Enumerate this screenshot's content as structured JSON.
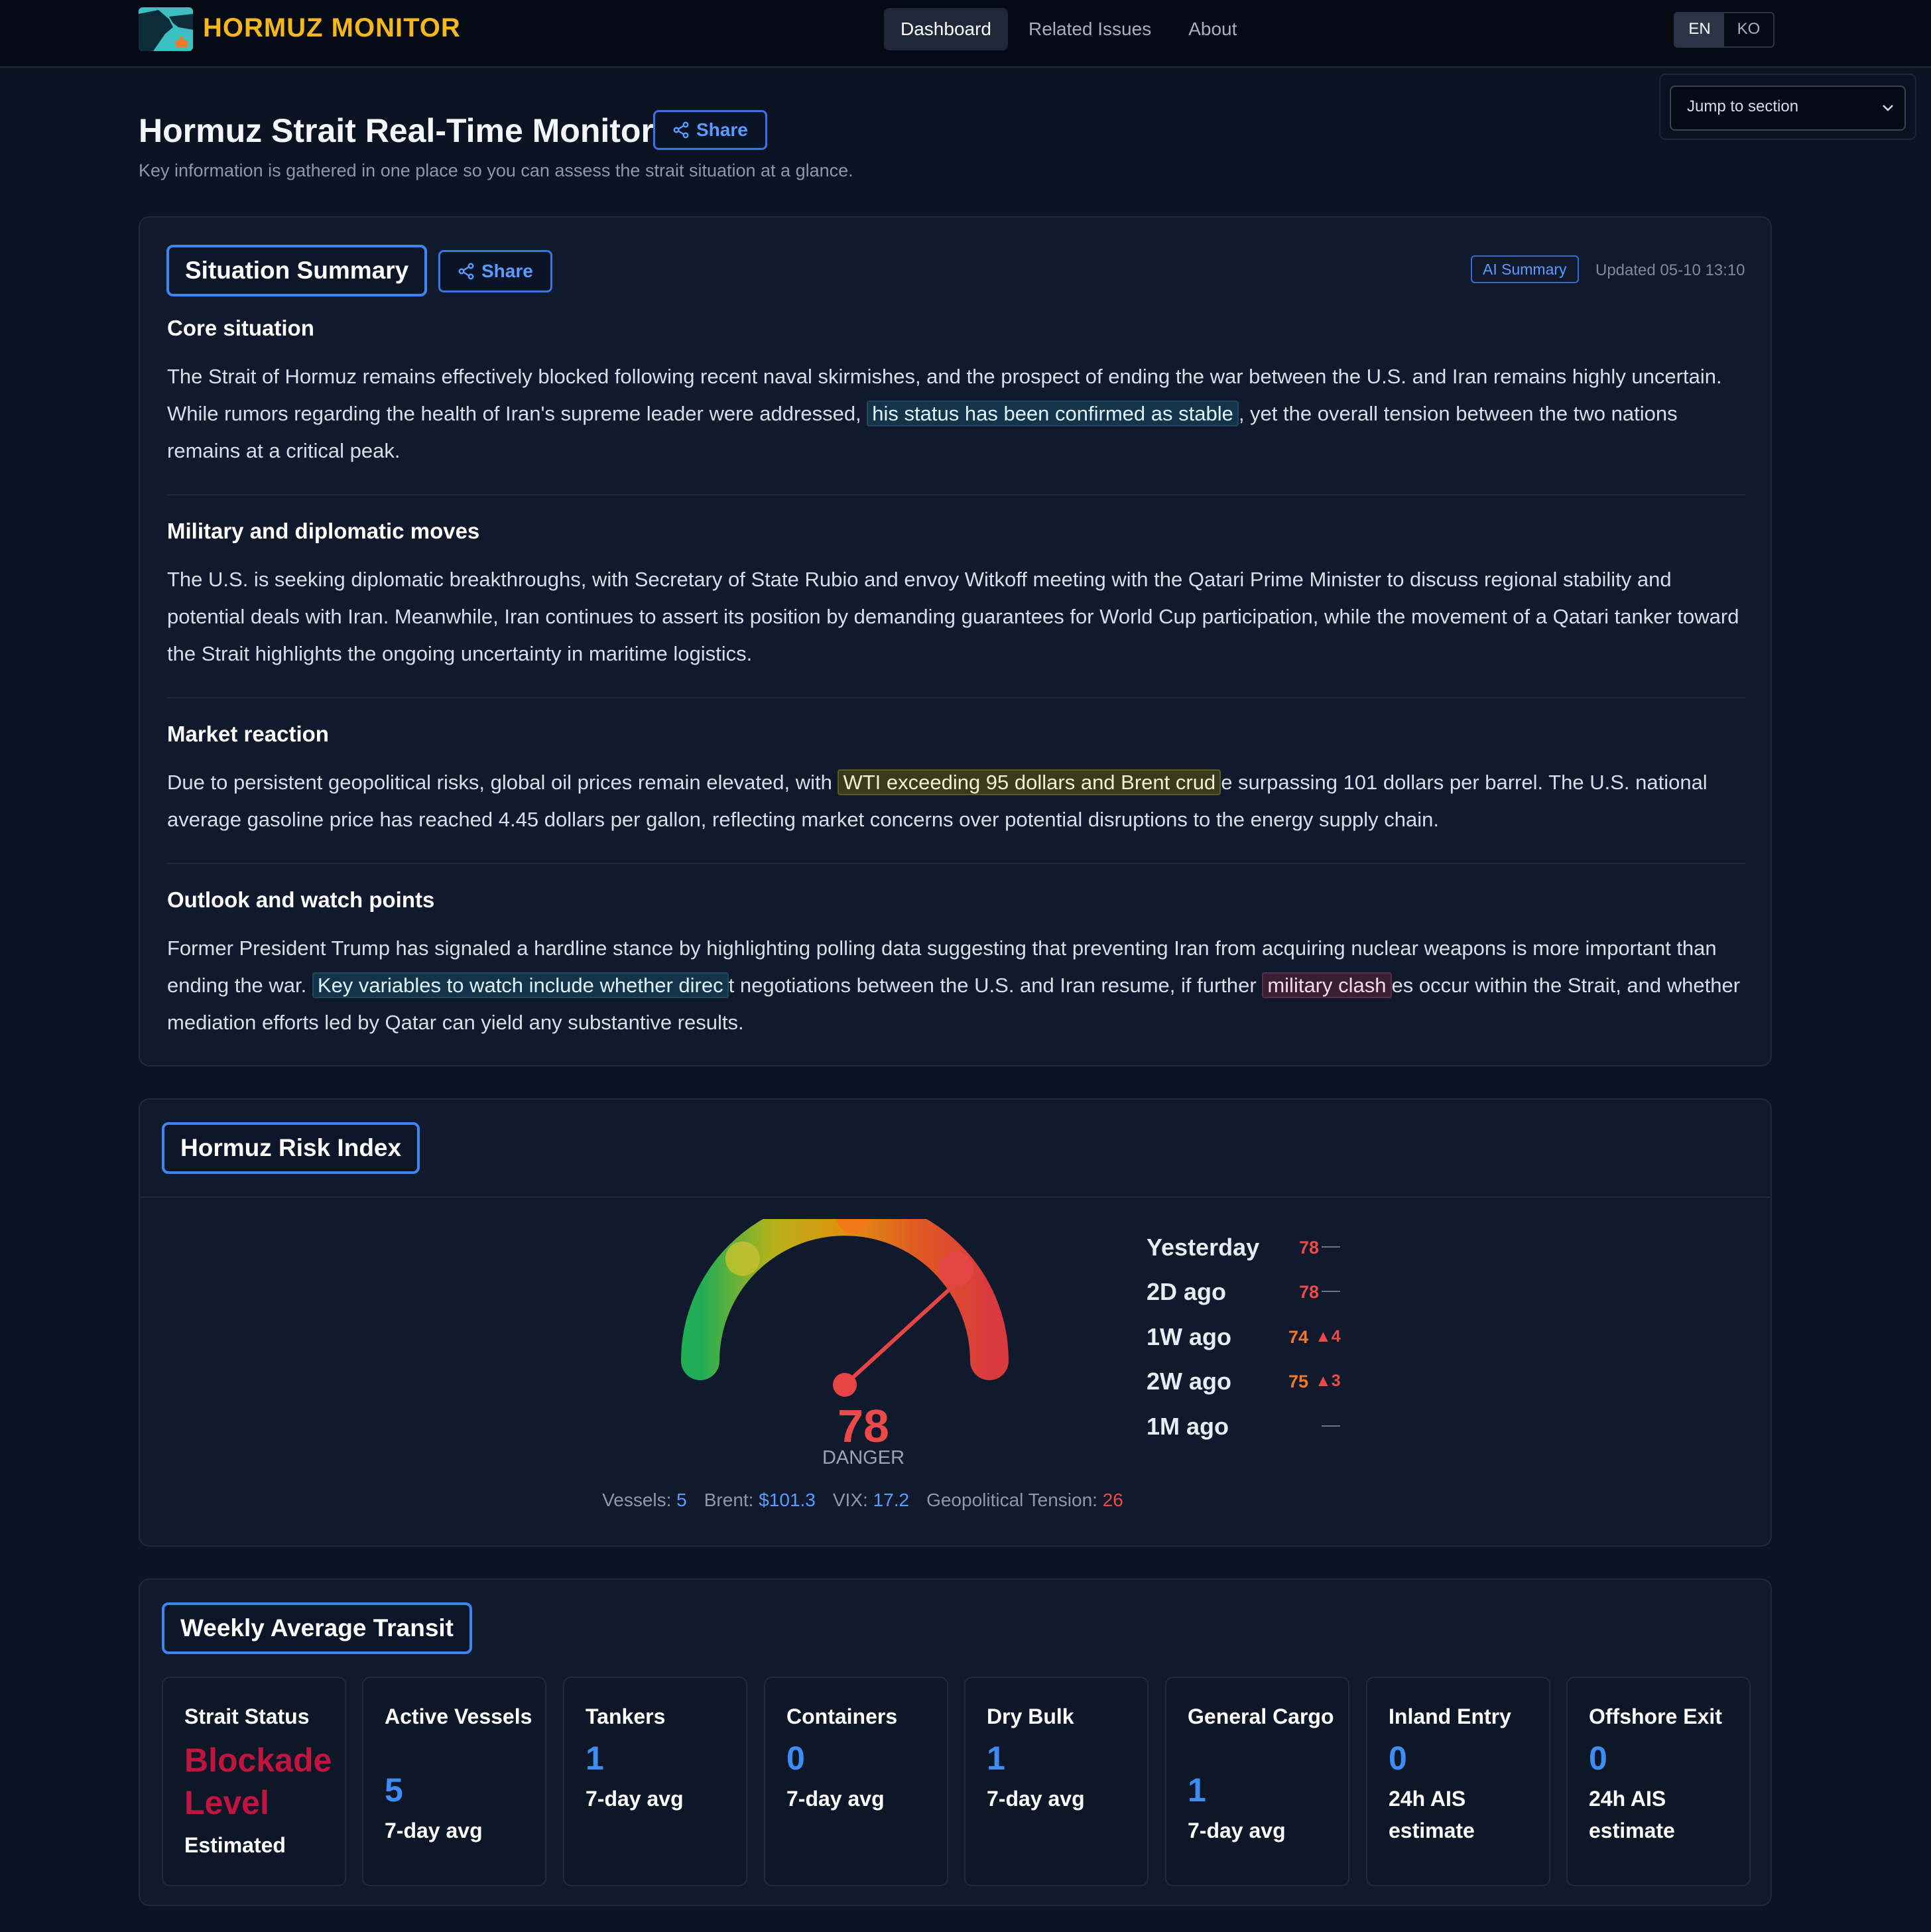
{
  "app": {
    "name": "HORMUZ MONITOR",
    "nav": [
      "Dashboard",
      "Related Issues",
      "About"
    ],
    "active_nav": "Dashboard",
    "lang": [
      "EN",
      "KO"
    ],
    "active_lang": "EN"
  },
  "jump": {
    "label": "Jump to section"
  },
  "header": {
    "title": "Hormuz Strait Real-Time Monitor",
    "share_label": "Share",
    "subtitle": "Key information is gathered in one place so you can assess the strait situation at a glance."
  },
  "summary": {
    "title": "Situation Summary",
    "share_label": "Share",
    "badge": "AI Summary",
    "updated": "Updated 05-10 13:10",
    "sections": [
      {
        "heading": "Core situation",
        "before": "The Strait of Hormuz remains effectively blocked following recent naval skirmishes, and the prospect of ending the war between the U.S. and Iran remains highly uncertain. While rumors regarding the health of Iran's supreme leader were addressed, ",
        "highlight": "his status has been confirmed as stable",
        "after": ", yet the overall tension between the two nations remains at a critical peak."
      },
      {
        "heading": "Military and diplomatic moves",
        "text": "The U.S. is seeking diplomatic breakthroughs, with Secretary of State Rubio and envoy Witkoff meeting with the Qatari Prime Minister to discuss regional stability and potential deals with Iran. Meanwhile, Iran continues to assert its position by demanding guarantees for World Cup participation, while the movement of a Qatari tanker toward the Strait highlights the ongoing uncertainty in maritime logistics."
      },
      {
        "heading": "Market reaction",
        "before": "Due to persistent geopolitical risks, global oil prices remain elevated, with ",
        "highlight": "WTI exceeding 95 dollars and Brent crud",
        "after": "e surpassing 101 dollars per barrel. The U.S. national average gasoline price has reached 4.45 dollars per gallon, reflecting market concerns over potential disruptions to the energy supply chain."
      },
      {
        "heading": "Outlook and watch points",
        "before": "Former President Trump has signaled a hardline stance by highlighting polling data suggesting that preventing Iran from acquiring nuclear weapons is more important than ending the war. ",
        "highlight": "Key variables to watch include whether direc",
        "middle": "t negotiations between the U.S. and Iran resume, if further ",
        "highlight2": "military clash",
        "after": "es occur within the Strait, and whether mediation efforts led by Qatar can yield any substantive results."
      }
    ]
  },
  "risk": {
    "title": "Hormuz Risk Index",
    "value": "78",
    "level": "DANGER",
    "gauge_fraction": 0.78,
    "stats": {
      "vessels_label": "Vessels:",
      "vessels": "5",
      "brent_label": "Brent:",
      "brent": "$101.3",
      "vix_label": "VIX:",
      "vix": "17.2",
      "tension_label": "Geopolitical Tension:",
      "tension": "26"
    },
    "history": [
      {
        "label": "Yesterday",
        "value": "78",
        "change": "—",
        "color": "#ea4a4a"
      },
      {
        "label": "2D ago",
        "value": "78",
        "change": "—",
        "color": "#ea4a4a"
      },
      {
        "label": "1W ago",
        "value": "74",
        "change": "▲4",
        "color": "#f07a2a"
      },
      {
        "label": "2W ago",
        "value": "75",
        "change": "▲3",
        "color": "#f07a2a"
      },
      {
        "label": "1M ago",
        "value": "",
        "change": "—",
        "color": "#6f7a8c"
      }
    ],
    "colors": {
      "danger": "#ea4a4a",
      "warning": "#f07a2a",
      "accent": "#5b9bff"
    }
  },
  "transit": {
    "title": "Weekly Average Transit",
    "status": {
      "label": "Strait Status",
      "value": "Blockade Level",
      "sub": "Estimated"
    },
    "tiles": [
      {
        "label": "Active Vessels",
        "value": "5",
        "sub": "7-day avg"
      },
      {
        "label": "Tankers",
        "value": "1",
        "sub": "7-day avg"
      },
      {
        "label": "Containers",
        "value": "0",
        "sub": "7-day avg"
      },
      {
        "label": "Dry Bulk",
        "value": "1",
        "sub": "7-day avg"
      },
      {
        "label": "General Cargo",
        "value": "1",
        "sub": "7-day avg"
      },
      {
        "label": "Inland Entry",
        "value": "0",
        "sub": "24h AIS estimate"
      },
      {
        "label": "Offshore Exit",
        "value": "0",
        "sub": "24h AIS estimate"
      }
    ]
  }
}
